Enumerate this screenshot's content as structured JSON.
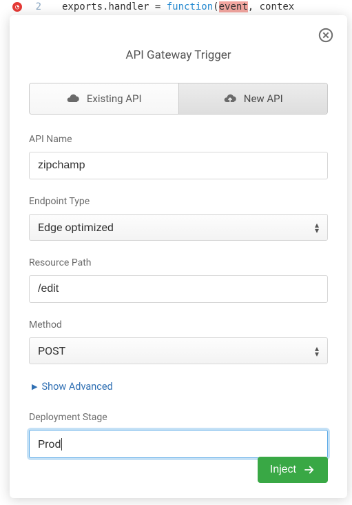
{
  "editor": {
    "line_number": "2",
    "tokens": {
      "t1": "exports",
      "t2": ".handler ",
      "t3": "= ",
      "t4": "function",
      "t5": "(",
      "t6": "event",
      "t7": ", contex"
    }
  },
  "modal": {
    "title": "API Gateway Trigger",
    "tabs": {
      "existing": "Existing API",
      "new": "New API"
    },
    "fields": {
      "api_name": {
        "label": "API Name",
        "value": "zipchamp"
      },
      "endpoint_type": {
        "label": "Endpoint Type",
        "value": "Edge optimized"
      },
      "resource_path": {
        "label": "Resource Path",
        "value": "/edit"
      },
      "method": {
        "label": "Method",
        "value": "POST"
      },
      "deployment_stage": {
        "label": "Deployment Stage",
        "value": "Prod"
      }
    },
    "show_advanced": "Show Advanced",
    "inject": "Inject"
  }
}
